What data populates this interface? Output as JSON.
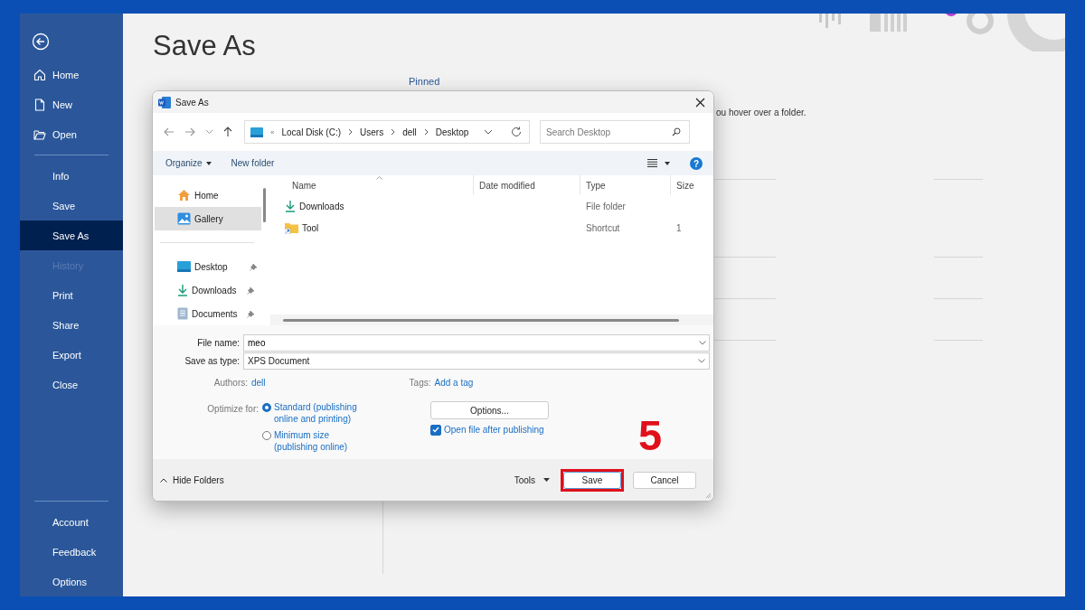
{
  "sidebar": {
    "top_items": [
      {
        "label": "Home",
        "selected": false,
        "disabled": false
      },
      {
        "label": "New",
        "selected": false,
        "disabled": false
      },
      {
        "label": "Open",
        "selected": false,
        "disabled": false
      }
    ],
    "middle_items": [
      {
        "label": "Info",
        "selected": false,
        "disabled": false
      },
      {
        "label": "Save",
        "selected": false,
        "disabled": false
      },
      {
        "label": "Save As",
        "selected": true,
        "disabled": false
      },
      {
        "label": "History",
        "selected": false,
        "disabled": true
      },
      {
        "label": "Print",
        "selected": false,
        "disabled": false
      },
      {
        "label": "Share",
        "selected": false,
        "disabled": false
      },
      {
        "label": "Export",
        "selected": false,
        "disabled": false
      },
      {
        "label": "Close",
        "selected": false,
        "disabled": false
      }
    ],
    "bottom_items": [
      {
        "label": "Account",
        "selected": false,
        "disabled": false
      },
      {
        "label": "Feedback",
        "selected": false,
        "disabled": false
      },
      {
        "label": "Options",
        "selected": false,
        "disabled": false
      }
    ]
  },
  "page": {
    "title": "Save As",
    "pinned_heading": "Pinned",
    "hint": "ou hover over a folder."
  },
  "dialog": {
    "title": "Save As",
    "breadcrumb_prefix": "«",
    "breadcrumb": [
      "Local Disk (C:)",
      "Users",
      "dell",
      "Desktop"
    ],
    "search": {
      "placeholder": "Search Desktop"
    },
    "toolbar": {
      "organize": "Organize",
      "new_folder": "New folder",
      "help": "?"
    },
    "nav_main": [
      {
        "label": "Home",
        "kind": "home",
        "selected": false
      },
      {
        "label": "Gallery",
        "kind": "gallery",
        "selected": true
      }
    ],
    "nav_quick": [
      {
        "label": "Desktop",
        "kind": "desktop",
        "selected": false,
        "pinned": true
      },
      {
        "label": "Downloads",
        "kind": "download",
        "selected": false,
        "pinned": true
      },
      {
        "label": "Documents",
        "kind": "documents",
        "selected": false,
        "pinned": true
      }
    ],
    "columns": [
      "Name",
      "Date modified",
      "Type",
      "Size"
    ],
    "files": [
      {
        "name": "Downloads",
        "kind": "download",
        "type": "File folder"
      },
      {
        "name": "Tool",
        "kind": "shortcut",
        "type": "Shortcut",
        "size": "1"
      }
    ],
    "file_name_label": "File name:",
    "file_name": "meo",
    "type_label": "Save as type:",
    "save_type": "XPS Document",
    "authors_label": "Authors:",
    "authors": "dell",
    "tags_label": "Tags:",
    "tags": "Add a tag",
    "optimize_label": "Optimize for:",
    "optimize_options": [
      {
        "label": "Standard (publishing online and printing)",
        "selected": true
      },
      {
        "label": "Minimum size (publishing online)",
        "selected": false
      }
    ],
    "options_button": "Options...",
    "open_after": {
      "label": "Open file after publishing",
      "checked": true
    },
    "hide_folders": "Hide Folders",
    "tools": "Tools",
    "buttons": [
      {
        "label": "Save",
        "highlighted": true
      },
      {
        "label": "Cancel",
        "highlighted": false
      }
    ]
  },
  "annotation": {
    "step": "5"
  }
}
